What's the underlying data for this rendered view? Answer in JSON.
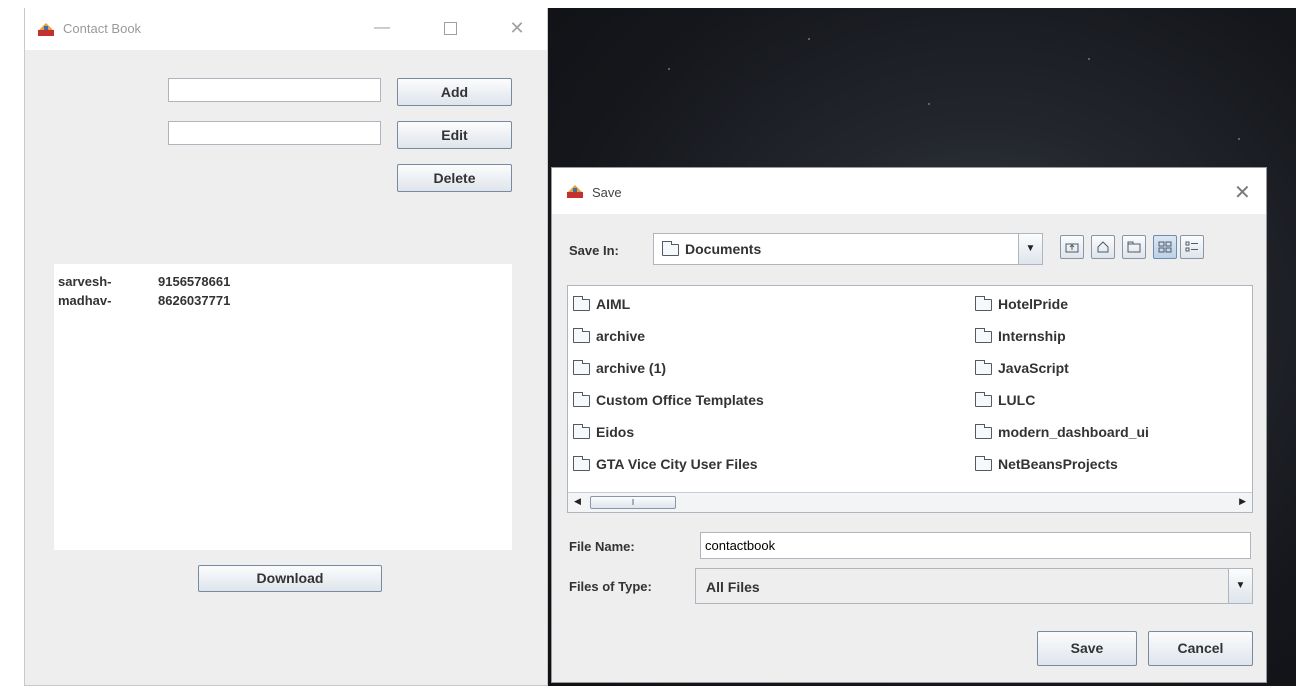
{
  "contact_book": {
    "title": "Contact Book",
    "name_input_value": "",
    "number_input_value": "",
    "add_label": "Add",
    "edit_label": "Edit",
    "delete_label": "Delete",
    "download_label": "Download",
    "contacts": [
      {
        "name": "sarvesh-",
        "number": "9156578661"
      },
      {
        "name": "madhav-",
        "number": "8626037771"
      }
    ],
    "minimize_glyph": "—",
    "close_glyph": "✕"
  },
  "save_dialog": {
    "title": "Save",
    "close_glyph": "✕",
    "save_in_label": "Save In:",
    "save_in_value": "Documents",
    "files_left": [
      "AIML",
      "archive",
      "archive (1)",
      "Custom Office Templates",
      "Eidos",
      "GTA Vice City User Files"
    ],
    "files_right": [
      "HotelPride",
      "Internship",
      "JavaScript",
      "LULC",
      "modern_dashboard_ui",
      "NetBeansProjects"
    ],
    "file_name_label": "File Name:",
    "file_name_value": "contactbook",
    "files_of_type_label": "Files of Type:",
    "files_of_type_value": "All Files",
    "save_label": "Save",
    "cancel_label": "Cancel"
  },
  "icons": {
    "app": "java-cup-icon",
    "folder": "folder-icon",
    "up_folder": "up-one-level-icon",
    "home": "home-icon",
    "new_folder": "new-folder-icon",
    "list_view": "list-view-icon",
    "details_view": "details-view-icon"
  }
}
